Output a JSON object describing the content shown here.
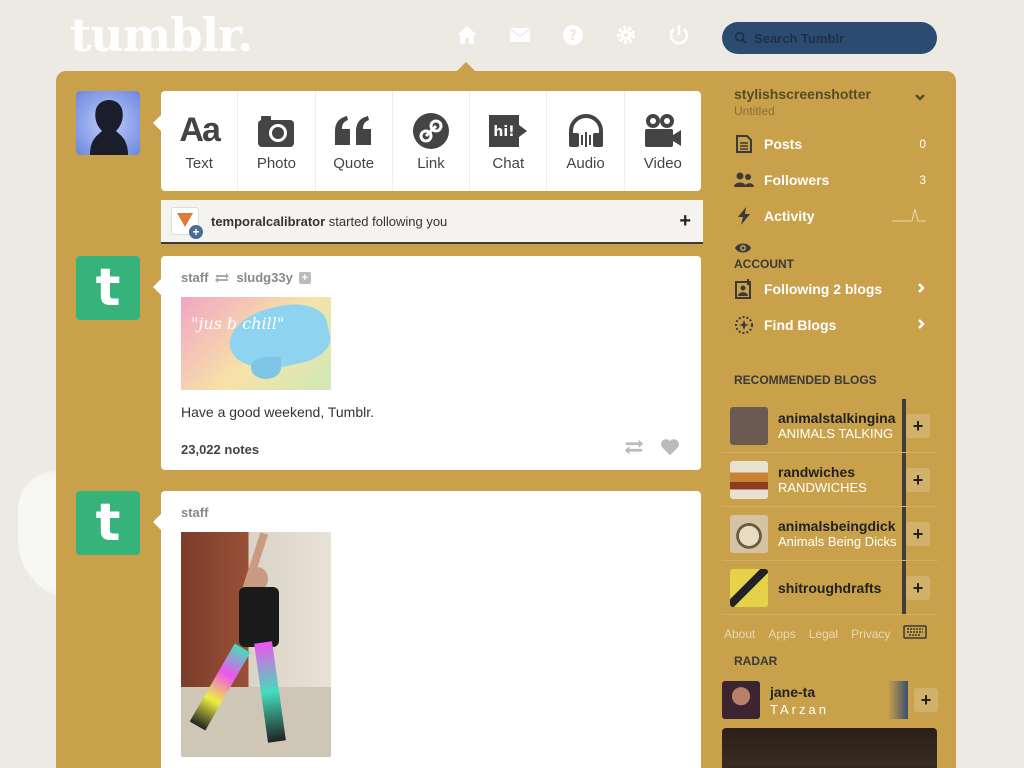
{
  "header": {
    "logo": "tumblr.",
    "nav_icons": [
      "home-icon",
      "mail-icon",
      "help-icon",
      "gear-icon",
      "power-icon"
    ],
    "search_placeholder": "Search Tumblr"
  },
  "post_types": [
    {
      "label": "Text",
      "icon": "text-icon",
      "glyph": "Aa"
    },
    {
      "label": "Photo",
      "icon": "camera-icon"
    },
    {
      "label": "Quote",
      "icon": "quote-icon",
      "glyph": "66"
    },
    {
      "label": "Link",
      "icon": "link-icon"
    },
    {
      "label": "Chat",
      "icon": "chat-icon",
      "glyph": "hi!"
    },
    {
      "label": "Audio",
      "icon": "headphones-icon"
    },
    {
      "label": "Video",
      "icon": "video-camera-icon"
    }
  ],
  "notification": {
    "user": "temporalcalibrator",
    "text": "started following you"
  },
  "posts": [
    {
      "author": "staff",
      "reblogged_from": "sludg33y",
      "image_text": "\"jus b chill\"",
      "body": "Have a good weekend, Tumblr.",
      "notes": "23,022 notes"
    },
    {
      "author": "staff"
    }
  ],
  "sidebar": {
    "username": "stylishscreenshotter",
    "subtitle": "Untitled",
    "stats": [
      {
        "label": "Posts",
        "count": "0",
        "icon": "posts-icon"
      },
      {
        "label": "Followers",
        "count": "3",
        "icon": "followers-icon"
      },
      {
        "label": "Activity",
        "count": "",
        "icon": "activity-icon"
      }
    ],
    "account_heading": "ACCOUNT",
    "account_links": [
      {
        "label": "Following 2 blogs",
        "icon": "following-icon"
      },
      {
        "label": "Find Blogs",
        "icon": "find-blogs-icon"
      }
    ],
    "recommended_heading": "RECOMMENDED BLOGS",
    "recommended": [
      {
        "name": "animalstalkingina",
        "sub": "ANIMALS TALKING",
        "color": "#6b5a52"
      },
      {
        "name": "randwiches",
        "sub": "RANDWICHES",
        "color": "#c9822f"
      },
      {
        "name": "animalsbeingdick",
        "sub": "Animals Being Dicks",
        "color": "#d6c3a3"
      },
      {
        "name": "shitroughdrafts",
        "sub": "",
        "color": "#e6d24a"
      }
    ],
    "footer_links": [
      "About",
      "Apps",
      "Legal",
      "Privacy"
    ],
    "radar_heading": "RADAR",
    "radar": {
      "name": "jane-ta",
      "sub": "TArzan",
      "color": "#3a2530"
    }
  },
  "colors": {
    "panel": "#c8a14a",
    "background": "#ede9e3",
    "search": "#2c4b70",
    "staff_avatar": "#36b37b"
  }
}
